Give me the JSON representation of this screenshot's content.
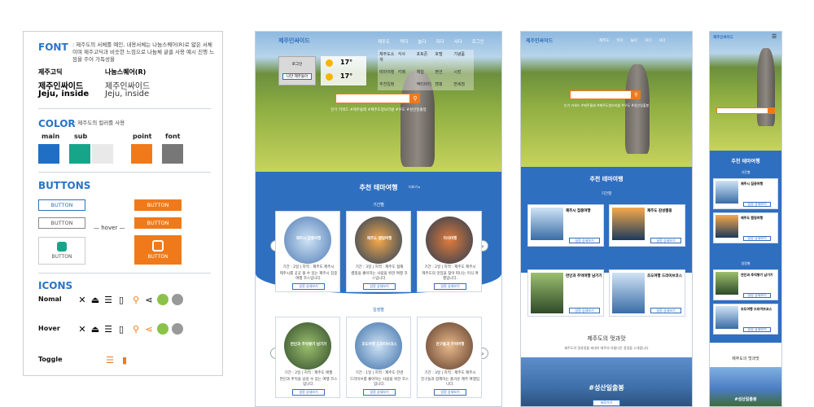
{
  "guide": {
    "font": {
      "title": "FONT",
      "note": ": 제주도의 서체를 예인, 내용서체는 나눔스퀘어(R)로 얇은 서체이며 제주고딕과 비슷한 느낌으로 나눔체 글꼴 사용 예시 진행 느낌을 주어 가독성을",
      "left_name": "제주고딕",
      "right_name": "나눔스퀘어(R)",
      "left_sample_1": "제주인싸이드",
      "left_sample_2": "Jeju, inside",
      "right_sample_1": "제주인싸이드",
      "right_sample_2": "Jeju, inside"
    },
    "color": {
      "title": "COLOR",
      "note": ": 제주도의 컬러를 사용",
      "labels": [
        "main",
        "sub",
        "point",
        "font"
      ],
      "swatches": [
        "#1f6fc5",
        "#17a58a",
        "#e9e9e9",
        "#f07a1a",
        "#777777"
      ]
    },
    "buttons": {
      "title": "BUTTONS",
      "label": "BUTTON",
      "hover": "— hover —"
    },
    "icons": {
      "title": "ICONS",
      "rows": [
        "Nomal",
        "Hover",
        "Toggle"
      ]
    }
  },
  "desktop": {
    "logo": "제주인싸이드",
    "nav": [
      "제주도",
      "먹다",
      "놀다",
      "자다",
      "사다",
      "로그인"
    ],
    "submenu": [
      [
        "제주도소개",
        "식사",
        "포토존",
        "호텔",
        "기념품"
      ],
      [
        "테마여행",
        "카페",
        "체험",
        "펜션",
        "시장"
      ],
      [
        "추천일정",
        "",
        "액티비티",
        "캠핑",
        "면세점"
      ]
    ],
    "weather": [
      {
        "temp": "17°"
      },
      {
        "temp": "17°"
      }
    ],
    "login_btn": "로그인",
    "join_btn": "나만 제주돌아",
    "hashtags": "인기 키워드 #제주올레  #제주도청보리밭  #우도  #성산일출봉",
    "section_title": "추천 테마여행",
    "more": "더보기 ▸",
    "period_label": "기간별",
    "regional_label": "일정별",
    "cards_top": [
      {
        "title": "제주시 집중여행",
        "meta": "기간 : 2일   |   지역 : 제주도 제주시",
        "desc": "제주시를 곳곳 볼 수 있는 제주시 집중 여행 코스입니다.",
        "btn": "일정 상세보기"
      },
      {
        "title": "제주도 캠핑여행",
        "meta": "기간 : 3일   |   지역 : 제주도 협재",
        "desc": "캠핑을 좋아하는 사람을 위한 여행 코스입니다.",
        "btn": "일정 상세보기"
      },
      {
        "title": "미식여행",
        "meta": "기간 : 2일   |   지역 : 제주도 제주시",
        "desc": "제주도의 맛집을 찾아 떠나는 미식 여행입니다.",
        "btn": "일정 상세보기"
      }
    ],
    "cards_bottom": [
      {
        "title": "연인과 추억쌓기 남기기",
        "meta": "기간 : 2일   |   지역 : 제주도 애월",
        "desc": "연인과 추억을 남길 수 있는 여행 코스입니다.",
        "btn": "일정 상세보기"
      },
      {
        "title": "조도여행 드라이브코스",
        "meta": "기간 : 1일   |   지역 : 제주도 한경",
        "desc": "드라이브를 좋아하는 사람을 위한 코스입니다.",
        "btn": "일정 상세보기"
      },
      {
        "title": "친구들과 추억여행",
        "meta": "기간 : 3일   |   지역 : 제주도 제주시",
        "desc": "친구들과 함께하는 즐거운 제주 여행입니다.",
        "btn": "일정 상세보기"
      }
    ]
  },
  "tablet": {
    "logo": "제주인싸이드",
    "nav": [
      "제주도",
      "먹다",
      "놀다",
      "자다",
      "사다"
    ],
    "hashtags": "인기 키워드 #제주올레  #제주도청보리밭  #우도  #성산일출봉",
    "section_title": "추천 테마여행",
    "period_label": "기간별",
    "regional_label": "일정별",
    "cards": [
      {
        "title": "제주시 집중여행",
        "btn": "일정 상세보기"
      },
      {
        "title": "제주도 감성캠핑",
        "btn": "일정 상세보기"
      },
      {
        "title": "연인과 추억여행 남기기",
        "btn": "일정 상세보기"
      },
      {
        "title": "조도여행 드라이브코스",
        "btn": "일정 상세보기"
      }
    ],
    "scenery_title": "제주도의 멋과맛",
    "scenery_sub": "제주도의 멋과맛을 캐내어 제주의 아름다운 풍경을 소개합니다",
    "bottom_tag": "#성산일출봉",
    "bottom_btn": "바로가기"
  },
  "mobile": {
    "logo": "제주인싸이드",
    "section_title": "추천 테마여행",
    "period_label": "기간별",
    "regional_label": "일정별",
    "cards": [
      "제주시 집중여행",
      "제주도 캠핑여행",
      "연인과 추억쌓기 남기기",
      "조도여행 드라이브코스"
    ],
    "btn": "일정 상세보기",
    "scenery_title": "제주도의 멋과맛",
    "bottom_tag": "#성산일출봉"
  }
}
